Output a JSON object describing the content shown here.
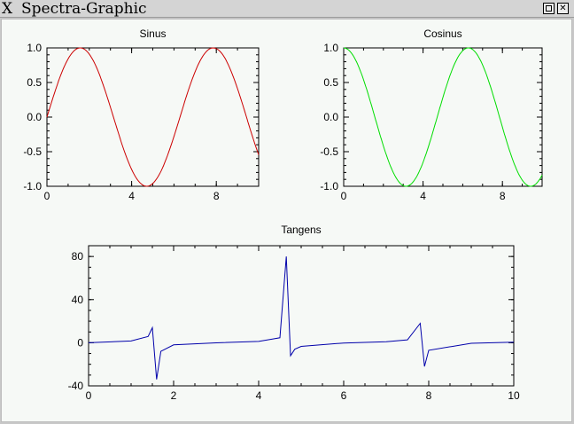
{
  "window": {
    "title": "Spectra-Graphic",
    "maximize_icon": "maximize-icon",
    "close_icon": "close-icon",
    "close_glyph": "✕"
  },
  "colors": {
    "sin": "#cc0000",
    "cos": "#00dd00",
    "tan": "#0000aa",
    "background": "#f6f9f6"
  },
  "chart_data": [
    {
      "type": "line",
      "title": "Sinus",
      "xlim": [
        0,
        10
      ],
      "ylim": [
        -1,
        1
      ],
      "xticks": [
        "0",
        "4",
        "8"
      ],
      "yticks": [
        "1.0",
        "0.5",
        "0.0",
        "-0.5",
        "-1.0"
      ],
      "series": [
        {
          "function": "sin",
          "x": [
            0,
            10
          ]
        }
      ]
    },
    {
      "type": "line",
      "title": "Cosinus",
      "xlim": [
        0,
        10
      ],
      "ylim": [
        -1,
        1
      ],
      "xticks": [
        "0",
        "4",
        "8"
      ],
      "yticks": [
        "1.0",
        "0.5",
        "0.0",
        "-0.5",
        "-1.0"
      ],
      "series": [
        {
          "function": "cos",
          "x": [
            0,
            10
          ]
        }
      ]
    },
    {
      "type": "line",
      "title": "Tangens",
      "xlim": [
        0,
        10
      ],
      "ylim": [
        -40,
        90
      ],
      "xticks": [
        "0",
        "2",
        "4",
        "6",
        "8",
        "10"
      ],
      "yticks": [
        "80",
        "40",
        "0",
        "-40"
      ],
      "series": [
        {
          "function": "tan",
          "x": [
            0,
            1.0,
            1.4,
            1.5,
            1.6,
            1.7,
            2.0,
            3.0,
            4.0,
            4.5,
            4.65,
            4.75,
            4.85,
            5.0,
            6.0,
            7.0,
            7.5,
            7.8,
            7.9,
            8.0,
            9.0,
            10.0
          ],
          "y": [
            0,
            1.6,
            5.8,
            14,
            -34,
            -8,
            -2,
            -0.1,
            1.2,
            4.6,
            80,
            -12,
            -6,
            -3.4,
            -0.3,
            0.9,
            2.7,
            18,
            -22,
            -7,
            -0.5,
            0.6
          ]
        }
      ]
    }
  ]
}
